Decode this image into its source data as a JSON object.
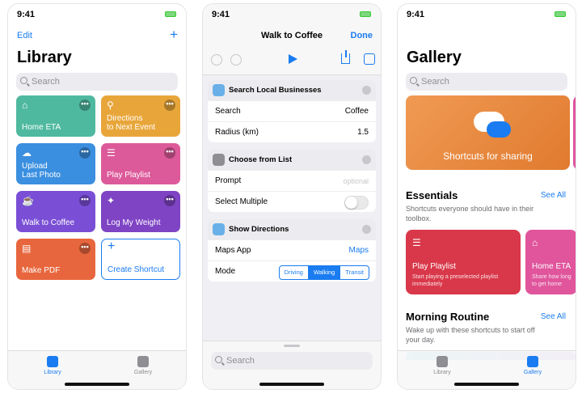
{
  "status": {
    "time": "9:41"
  },
  "library": {
    "edit_label": "Edit",
    "add_label": "+",
    "title": "Library",
    "search_placeholder": "Search",
    "tiles": [
      {
        "label": "Home ETA",
        "icon": "⌂",
        "color": "#4fb9a0"
      },
      {
        "label": "Directions\nto Next Event",
        "icon": "⚲",
        "color": "#e8a63a"
      },
      {
        "label": "Upload\nLast Photo",
        "icon": "☁",
        "color": "#3b8fe0"
      },
      {
        "label": "Play Playlist",
        "icon": "☰",
        "color": "#dd5a9a"
      },
      {
        "label": "Walk to Coffee",
        "icon": "☕",
        "color": "#7a4fd6"
      },
      {
        "label": "Log My Weight",
        "icon": "✦",
        "color": "#7e44c4"
      },
      {
        "label": "Make PDF",
        "icon": "▤",
        "color": "#e8663d"
      },
      {
        "label": "Create Shortcut",
        "icon": "+",
        "color": "#ffffff"
      }
    ],
    "more_label": "•••",
    "tabs": {
      "library": "Library",
      "gallery": "Gallery"
    }
  },
  "editor": {
    "title": "Walk to Coffee",
    "done_label": "Done",
    "actions": [
      {
        "title": "Search Local Businesses",
        "icon_color": "#6ab0e8",
        "rows": [
          {
            "label": "Search",
            "value": "Coffee"
          },
          {
            "label": "Radius (km)",
            "value": "1.5"
          }
        ]
      },
      {
        "title": "Choose from List",
        "icon_color": "#8e8e93",
        "rows": [
          {
            "label": "Prompt",
            "value": "optional"
          },
          {
            "label": "Select Multiple",
            "value": ""
          }
        ]
      },
      {
        "title": "Show Directions",
        "icon_color": "#6ab0e8",
        "rows": [
          {
            "label": "Maps App",
            "value": "Maps"
          },
          {
            "label": "Mode",
            "value": ""
          }
        ]
      }
    ],
    "mode_options": [
      "Driving",
      "Walking",
      "Transit"
    ],
    "mode_selected": "Walking",
    "search_placeholder": "Search"
  },
  "gallery": {
    "title": "Gallery",
    "search_placeholder": "Search",
    "hero_label": "Shortcuts for sharing",
    "essentials": {
      "title": "Essentials",
      "see_all": "See All",
      "desc": "Shortcuts everyone should have in their toolbox.",
      "cards": [
        {
          "title": "Play Playlist",
          "desc": "Start playing a preselected playlist immediately",
          "color": "#d9384a"
        },
        {
          "title": "Home ETA",
          "desc": "Share how long to get home",
          "color": "#e0559c"
        }
      ]
    },
    "morning": {
      "title": "Morning Routine",
      "see_all": "See All",
      "desc": "Wake up with these shortcuts to start off your day."
    },
    "tabs": {
      "library": "Library",
      "gallery": "Gallery"
    }
  }
}
